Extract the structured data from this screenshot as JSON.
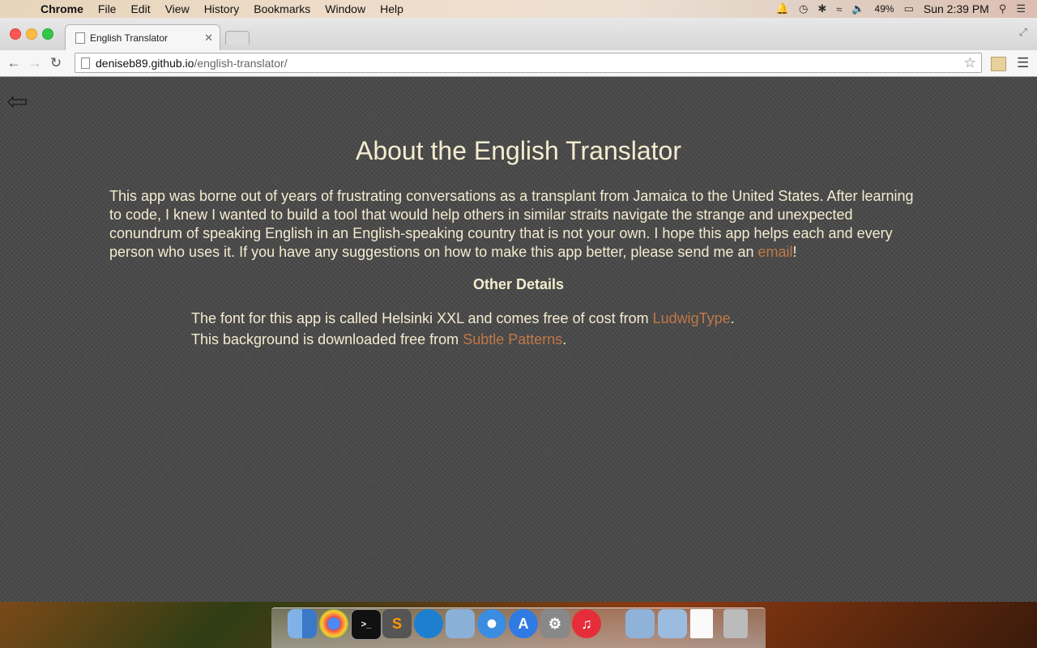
{
  "menubar": {
    "app_name": "Chrome",
    "items": [
      "File",
      "Edit",
      "View",
      "History",
      "Bookmarks",
      "Window",
      "Help"
    ],
    "battery": "49%",
    "clock": "Sun 2:39 PM"
  },
  "browser": {
    "tab_title": "English Translator",
    "url_host": "deniseb89.github.io",
    "url_path": "/english-translator/"
  },
  "page": {
    "title": "About the English Translator",
    "intro_text": "This app was borne out of years of frustrating conversations as a transplant from Jamaica to the United States. After learning to code, I knew I wanted to build a tool that would help others in similar straits navigate the strange and unexpected conundrum of speaking English in an English-speaking country that is not your own. I hope this app helps each and every person who uses it. If you have any suggestions on how to make this app better, please send me an ",
    "email_link": "email",
    "intro_end": "!",
    "details_heading": "Other Details",
    "font_line_prefix": "The font for this app is called Helsinki XXL and comes free of cost from ",
    "font_link": "LudwigType",
    "font_line_suffix": ".",
    "bg_line_prefix": "This background is downloaded free from ",
    "bg_link": "Subtle Patterns",
    "bg_line_suffix": "."
  },
  "colors": {
    "text": "#f4ecd0",
    "link": "#c07848",
    "page_bg": "#474747"
  },
  "dock_icons": [
    "finder-icon",
    "chrome-icon",
    "terminal-icon",
    "sublime-text-icon",
    "skype-icon",
    "preview-icon",
    "safari-icon",
    "app-store-icon",
    "system-preferences-icon",
    "itunes-icon",
    "applications-folder-icon",
    "documents-folder-icon",
    "file-icon",
    "trash-icon"
  ]
}
